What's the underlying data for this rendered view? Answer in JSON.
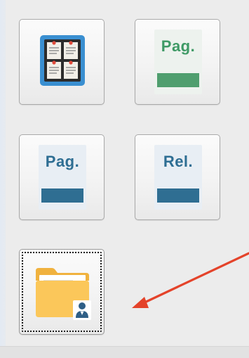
{
  "tiles": {
    "board": {
      "icon": "bulletin-board-icon"
    },
    "pag_green": {
      "label": "Pag.",
      "icon": "document-pag-green-icon",
      "label_color": "#3f9a66",
      "bar_color": "#4f9e6e"
    },
    "pag_blue": {
      "label": "Pag.",
      "icon": "document-pag-blue-icon",
      "label_color": "#2e6e93",
      "bar_color": "#2f6e92"
    },
    "rel_blue": {
      "label": "Rel.",
      "icon": "document-rel-blue-icon",
      "label_color": "#2e6e93",
      "bar_color": "#2f6e92"
    },
    "folder_user": {
      "icon": "folder-user-icon",
      "focused": true
    }
  },
  "annotation": {
    "icon": "red-arrow-icon",
    "color": "#e4432a"
  }
}
